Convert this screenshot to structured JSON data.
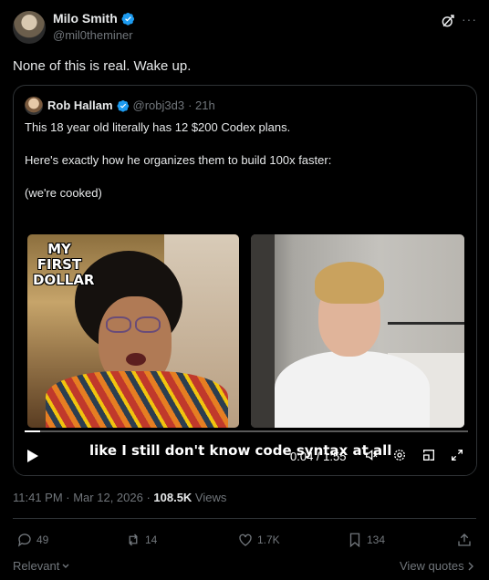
{
  "author": {
    "display_name": "Milo Smith",
    "handle": "@mil0theminer",
    "verified": true
  },
  "post": {
    "text": "None of this is real. Wake up."
  },
  "quote": {
    "author": {
      "display_name": "Rob Hallam",
      "handle": "@robj3d3",
      "time": "· 21h",
      "verified": true
    },
    "lines": [
      "This 18 year old literally has 12 $200 Codex plans.",
      "Here's exactly how he organizes them to build 100x faster:",
      "(we're cooked)"
    ],
    "video": {
      "meme_text": "MY FIRST DOLLAR",
      "caption": "like I still don't know code syntax at all",
      "timecode": "0:04 / 1:55",
      "progress": 0.035
    }
  },
  "meta": {
    "time": "11:41 PM · Mar 12, 2026 · ",
    "views_count": "108.5K",
    "views_label": " Views"
  },
  "actions": {
    "replies": "49",
    "reposts": "14",
    "likes": "1.7K",
    "bookmarks": "134"
  },
  "footer": {
    "sort_label": "Relevant",
    "view_quotes_label": "View quotes"
  },
  "colors": {
    "accent_verified": "#1d9bf0",
    "muted": "#71767b",
    "border": "#2f3336",
    "background": "#000000"
  }
}
